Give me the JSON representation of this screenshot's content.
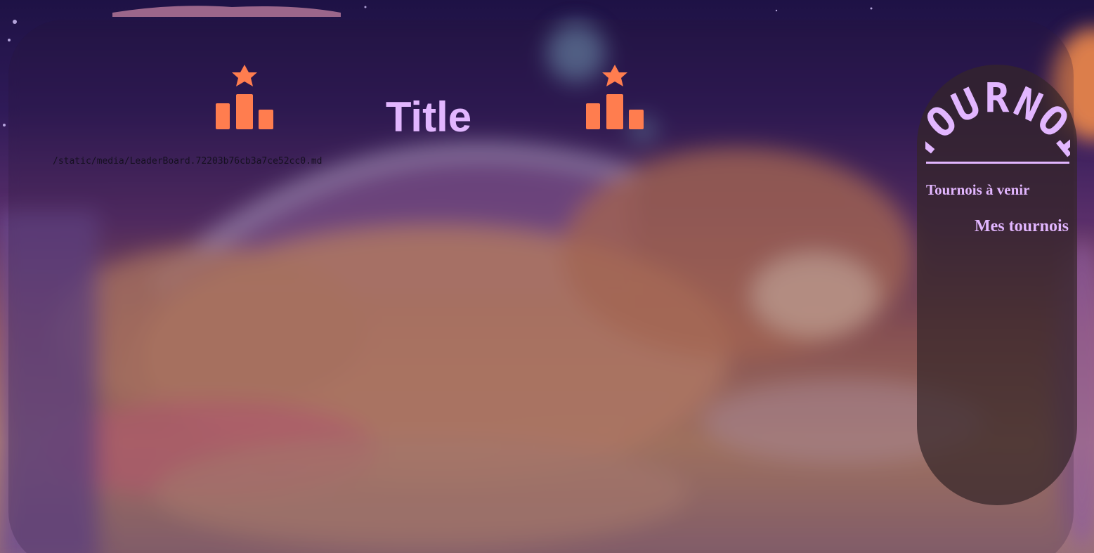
{
  "page": {
    "title": "Title",
    "content_path": "/static/media/LeaderBoard.72203b76cb3a7ce52cc0.md"
  },
  "icons": {
    "left": "podium-star-icon",
    "right": "podium-star-icon"
  },
  "sidebar": {
    "logo_text": "TOURNOI",
    "links": [
      {
        "label": "Tournois à venir"
      },
      {
        "label": "Mes tournois"
      }
    ]
  },
  "colors": {
    "accent": "#e2b6ff",
    "icon": "#ff7d4f"
  }
}
